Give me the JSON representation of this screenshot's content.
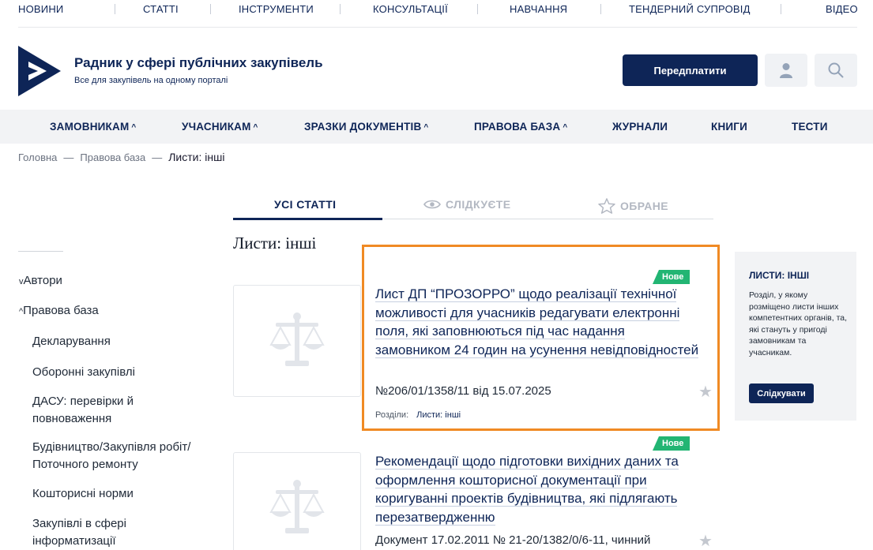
{
  "top_nav": [
    "НОВИНИ",
    "СТАТТІ",
    "ІНСТРУМЕНТИ",
    "КОНСУЛЬТАЦІЇ",
    "НАВЧАННЯ",
    "ТЕНДЕРНИЙ СУПРОВІД",
    "ВІДЕО"
  ],
  "header": {
    "title": "Радник у сфері публічних закупівель",
    "subtitle": "Все для закупівель на одному порталі",
    "subscribe_label": "Передплатити",
    "user_icon": "user-icon",
    "search_icon": "search-icon"
  },
  "main_nav": [
    {
      "label": "ЗАМОВНИКАМ",
      "caret": "^"
    },
    {
      "label": "УЧАСНИКАМ",
      "caret": "^"
    },
    {
      "label": "ЗРАЗКИ ДОКУМЕНТІВ",
      "caret": "^"
    },
    {
      "label": "ПРАВОВА БАЗА",
      "caret": "^"
    },
    {
      "label": "ЖУРНАЛИ",
      "caret": ""
    },
    {
      "label": "КНИГИ",
      "caret": ""
    },
    {
      "label": "ТЕСТИ",
      "caret": ""
    }
  ],
  "breadcrumb": {
    "items": [
      "Головна",
      "Правова база"
    ],
    "current": "Листи: інші",
    "separator": "—"
  },
  "tabs": [
    {
      "label": "УСІ СТАТТІ",
      "active": true,
      "icon": ""
    },
    {
      "label": "СЛІДКУЄТЕ",
      "active": false,
      "icon": "eye-icon"
    },
    {
      "label": "ОБРАНЕ",
      "active": false,
      "icon": "star-icon"
    }
  ],
  "section_title": "Листи: інші",
  "sidebar": {
    "groups": [
      {
        "label": "Автори",
        "caret": "v"
      },
      {
        "label": "Правова база",
        "caret": "^"
      }
    ],
    "items": [
      "Декларування",
      "Оборонні закупівлі",
      "ДАСУ: перевірки й повноваження",
      "Будівництво/Закупівля робіт/ Поточного ремонту",
      "Кошторисні норми",
      "Закупівлі в сфері інформатизації"
    ]
  },
  "articles": [
    {
      "badge": "Нове",
      "title": "Лист ДП “ПРОЗОРРО” щодо реалізації технічної можливості для учасників редагувати електронні поля, які заповнюються під час надання замовником 24 годин на усунення невідповідностей",
      "meta": "№206/01/1358/11 від 15.07.2025",
      "sections_label": "Розділи:",
      "sections_link": "Листи: інші",
      "thumb_icon": "scales-icon"
    },
    {
      "badge": "Нове",
      "title": "Рекомендації щодо підготовки вихідних даних та оформлення кошторисної документації при коригуванні проектів будівництва, які підлягають перезатвердженню",
      "meta": "Документ 17.02.2011 № 21-20/1382/0/6-11, чинний",
      "thumb_icon": "scales-icon"
    }
  ],
  "infobox": {
    "title": "ЛИСТИ: ІНШІ",
    "text": "Розділ, у якому розміщено листи інших компетентних органів, та, які стануть у пригоді замовникам та учасникам.",
    "button": "Слідкувати"
  },
  "colors": {
    "brand": "#0e2557",
    "badge": "#22b573",
    "highlight": "#f08a24",
    "nav_bg": "#f2f3f5"
  }
}
